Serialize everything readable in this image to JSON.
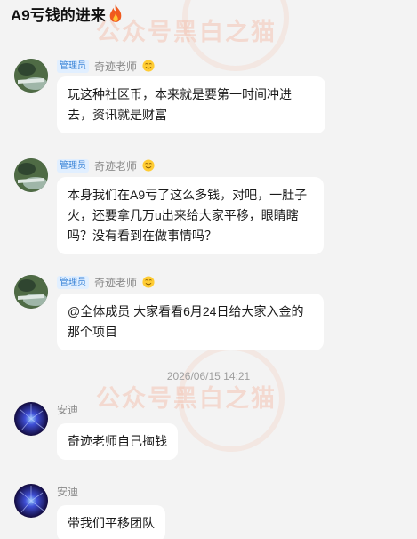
{
  "page": {
    "title": "A9亏钱的进来"
  },
  "watermark": {
    "text": "公众号黑白之猫"
  },
  "messages": [
    {
      "sender": "奇迹老师",
      "role": "管理员",
      "text": "玩这种社区币，本来就是要第一时间冲进去，资讯就是财富"
    },
    {
      "sender": "奇迹老师",
      "role": "管理员",
      "text": "本身我们在A9亏了这么多钱，对吧，一肚子火，还要拿几万u出来给大家平移，眼睛瞎吗？没有看到在做事情吗？"
    },
    {
      "sender": "奇迹老师",
      "role": "管理员",
      "text": "@全体成员 大家看看6月24日给大家入金的那个项目"
    },
    {
      "sender": "安迪",
      "role": "",
      "text": "奇迹老师自己掏钱"
    },
    {
      "sender": "安迪",
      "role": "",
      "text": "带我们平移团队"
    }
  ],
  "timestamp": "2026/06/15 14:21",
  "icons": {
    "title_icon": "fire-icon",
    "name_suffix_icon": "smile-emoji-icon"
  },
  "colors": {
    "background": "#f3f3f3",
    "bubble": "#ffffff",
    "badge_bg": "#e1efff",
    "badge_text": "#3d86d8"
  }
}
